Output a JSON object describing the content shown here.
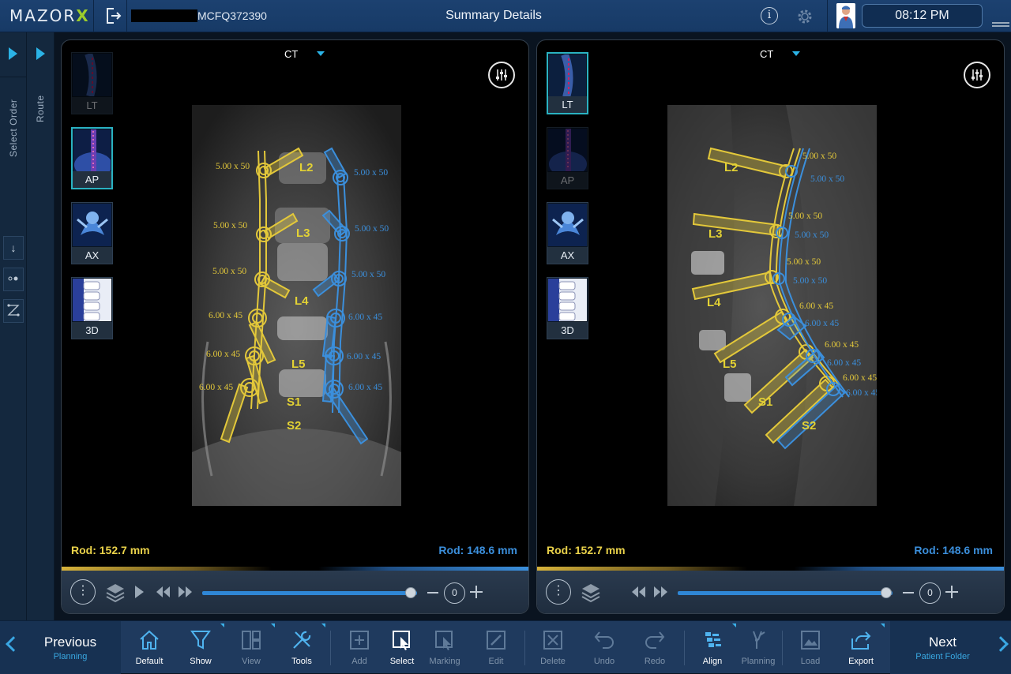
{
  "app": {
    "logo_text": "MAZOR",
    "logo_x": "X",
    "patient_id": "MCFQ372390",
    "title": "Summary Details",
    "time": "08:12 PM",
    "info_glyph": "i"
  },
  "left_rail": {
    "select_order_label": "Select Order",
    "route_label": "Route"
  },
  "panels": [
    {
      "modality": "CT",
      "views": [
        {
          "label": "LT",
          "state": "dim"
        },
        {
          "label": "AP",
          "state": "active"
        },
        {
          "label": "AX",
          "state": "normal"
        },
        {
          "label": "3D",
          "state": "normal"
        }
      ],
      "levels": [
        "L2",
        "L3",
        "L4",
        "L5",
        "S1",
        "S2"
      ],
      "left_sizes": [
        "5.00 x 50",
        "5.00 x 50",
        "5.00 x 50",
        "6.00 x 45",
        "6.00 x 45",
        "6.00 x 45"
      ],
      "right_sizes": [
        "5.00 x 50",
        "5.00 x 50",
        "5.00 x 50",
        "6.00 x 45",
        "6.00 x 45",
        "6.00 x 45"
      ],
      "rod_left": "Rod: 152.7 mm",
      "rod_right": "Rod: 148.6 mm",
      "zoom": "0",
      "slider_position": 0.97
    },
    {
      "modality": "CT",
      "views": [
        {
          "label": "LT",
          "state": "active"
        },
        {
          "label": "AP",
          "state": "dim"
        },
        {
          "label": "AX",
          "state": "normal"
        },
        {
          "label": "3D",
          "state": "normal"
        }
      ],
      "levels": [
        "L2",
        "L3",
        "L4",
        "L5",
        "S1",
        "S2"
      ],
      "left_sizes": [
        "5.00 x 50",
        "5.00 x 50",
        "5.00 x 50",
        "6.00 x 45",
        "6.00 x 45",
        "6.00 x 45"
      ],
      "right_sizes": [
        "5.00 x 50",
        "5.00 x 50",
        "5.00 x 50",
        "6.00 x 45",
        "6.00 x 45",
        "6.00 x 45"
      ],
      "rod_left": "Rod: 152.7 mm",
      "rod_right": "Rod: 148.6 mm",
      "zoom": "0",
      "slider_position": 0.97
    }
  ],
  "toolbar": {
    "prev_main": "Previous",
    "prev_sub": "Planning",
    "next_main": "Next",
    "next_sub": "Patient Folder",
    "tools": [
      {
        "label": "Default",
        "icon": "home-icon",
        "enabled": true
      },
      {
        "label": "Show",
        "icon": "filter-icon",
        "enabled": true
      },
      {
        "label": "View",
        "icon": "layout-icon",
        "enabled": false
      },
      {
        "label": "Tools",
        "icon": "tools-icon",
        "enabled": true
      },
      {
        "label": "Add",
        "icon": "add-icon",
        "enabled": false
      },
      {
        "label": "Select",
        "icon": "select-icon",
        "enabled": true
      },
      {
        "label": "Marking",
        "icon": "marking-icon",
        "enabled": false
      },
      {
        "label": "Edit",
        "icon": "edit-icon",
        "enabled": false
      },
      {
        "label": "Delete",
        "icon": "delete-icon",
        "enabled": false
      },
      {
        "label": "Undo",
        "icon": "undo-icon",
        "enabled": false
      },
      {
        "label": "Redo",
        "icon": "redo-icon",
        "enabled": false
      },
      {
        "label": "Align",
        "icon": "align-icon",
        "enabled": true
      },
      {
        "label": "Planning",
        "icon": "planning-icon",
        "enabled": false
      },
      {
        "label": "Load",
        "icon": "load-icon",
        "enabled": false
      },
      {
        "label": "Export",
        "icon": "export-icon",
        "enabled": true
      }
    ]
  },
  "colors": {
    "left_screw": "#e3c83a",
    "right_screw": "#3b8fdc",
    "accent": "#2bb3e6"
  }
}
